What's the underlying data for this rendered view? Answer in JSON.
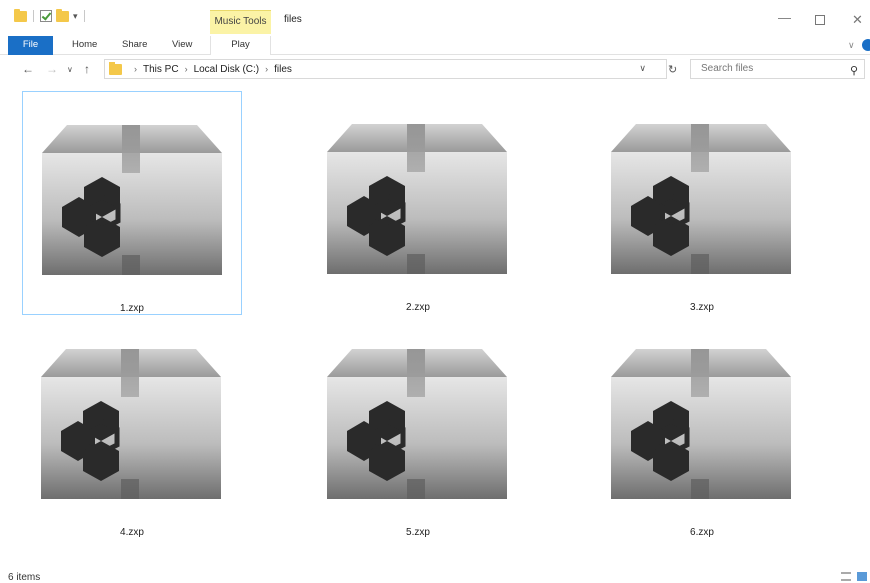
{
  "titlebar": {
    "context_tab": "Music Tools",
    "title": "files"
  },
  "ribbon": {
    "tabs": [
      "File",
      "Home",
      "Share",
      "View",
      "Play"
    ]
  },
  "address": {
    "crumbs": [
      "This PC",
      "Local Disk (C:)",
      "files"
    ]
  },
  "search": {
    "placeholder": "Search files"
  },
  "files": [
    {
      "name": "1.zxp",
      "selected": true
    },
    {
      "name": "2.zxp",
      "selected": false
    },
    {
      "name": "3.zxp",
      "selected": false
    },
    {
      "name": "4.zxp",
      "selected": false
    },
    {
      "name": "5.zxp",
      "selected": false
    },
    {
      "name": "6.zxp",
      "selected": false
    }
  ],
  "status": {
    "item_count": "6 items"
  },
  "colors": {
    "file_tab": "#1a6fc6",
    "music_tools": "#fbf3a6",
    "selection_border": "#99d1ff"
  },
  "icons": [
    "folder-icon",
    "checkbox-icon",
    "back-arrow-icon",
    "forward-arrow-icon",
    "up-arrow-icon",
    "refresh-icon",
    "search-icon",
    "zxp-package-icon",
    "details-view-icon",
    "large-icons-view-icon"
  ]
}
